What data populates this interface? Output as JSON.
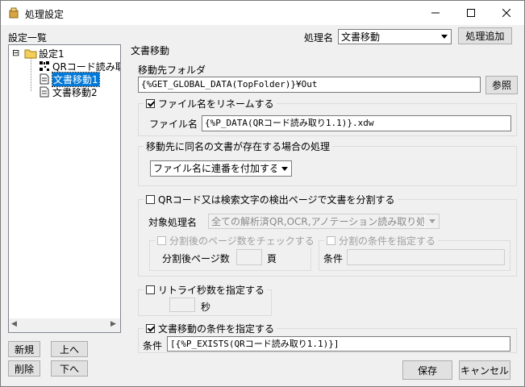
{
  "window": {
    "title": "処理設定",
    "min_glyph": "—",
    "max_glyph": "☐",
    "close_glyph": "✕"
  },
  "left": {
    "header": "設定一覧",
    "tree": [
      {
        "label": "設定1",
        "kind": "folder"
      },
      {
        "label": "QRコード読み取",
        "kind": "qr"
      },
      {
        "label": "文書移動1",
        "kind": "doc",
        "selected": true
      },
      {
        "label": "文書移動2",
        "kind": "doc"
      }
    ],
    "tree_expander": "⊟",
    "scroll_left": "◀",
    "scroll_right": "▶",
    "buttons": {
      "new": "新規",
      "up": "上へ",
      "delete": "削除",
      "down": "下へ"
    }
  },
  "top": {
    "section_label": "文書移動",
    "process_name_label": "処理名",
    "process_name_value": "文書移動",
    "add_process_button": "処理追加"
  },
  "dest": {
    "label": "移動先フォルダ",
    "value": "{%GET_GLOBAL_DATA(TopFolder)}¥Out",
    "browse_button": "参照"
  },
  "rename": {
    "checkbox_label": "ファイル名をリネームする",
    "checked": true,
    "filename_label": "ファイル名",
    "filename_value": "{%P_DATA(QRコード読み取り1.1)}.xdw"
  },
  "duplicate": {
    "group_label": "移動先に同名の文書が存在する場合の処理",
    "selected": "ファイル名に連番を付加する"
  },
  "split": {
    "checkbox_label": "QRコード又は検索文字の検出ページで文書を分割する",
    "checked": false,
    "target_label": "対象処理名",
    "target_value": "全ての解析済QR,OCR,アノテーション読み取り処理",
    "page_check_label": "分割後のページ数をチェックする",
    "page_count_label": "分割後ページ数",
    "page_unit": "頁",
    "cond_check_label": "分割の条件を指定する",
    "cond_label": "条件"
  },
  "retry": {
    "checkbox_label": "リトライ秒数を指定する",
    "checked": false,
    "unit": "秒"
  },
  "move_cond": {
    "checkbox_label": "文書移動の条件を指定する",
    "checked": true,
    "cond_label": "条件",
    "cond_value": "[{%P_EXISTS(QRコード読み取り1.1)}]"
  },
  "footer": {
    "ok": "保存",
    "cancel": "キャンセル"
  }
}
